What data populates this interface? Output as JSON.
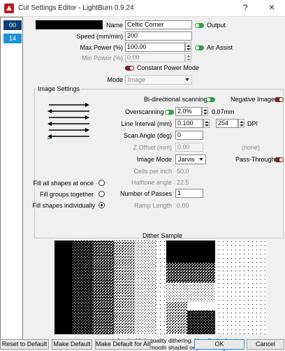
{
  "window": {
    "title": "Cut Settings Editor - LightBurn 0.9.24",
    "help_glyph": "?",
    "close_glyph": "×"
  },
  "layers": [
    {
      "label": "00",
      "color": "#0a3d78"
    },
    {
      "label": "14",
      "color": "#1e90d6"
    }
  ],
  "top": {
    "name_label": "Name",
    "name_value": "Celtic Corner",
    "output_label": "Output",
    "speed_label": "Speed (mm/min)",
    "speed_value": "200",
    "max_power_label": "Max Power (%)",
    "max_power_value": "100.00",
    "air_assist_label": "Air Assist",
    "min_power_label": "Min Power (%)",
    "min_power_value": "0.00",
    "constant_power_label": "Constant Power Mode",
    "mode_label": "Mode",
    "mode_value": "Image"
  },
  "image_settings": {
    "group_label": "Image Settings",
    "bidirectional_label": "Bi-directional scanning",
    "negative_label": "Negative Image",
    "overscanning_label": "Overscanning",
    "overscanning_value": "2.0%",
    "overscanning_mm": "0.07mm",
    "line_interval_label": "Line Interval (mm)",
    "line_interval_value": "0.100",
    "dpi_value": "254",
    "dpi_label": "DPI",
    "scan_angle_label": "Scan Angle (deg)",
    "scan_angle_value": "0",
    "z_offset_label": "Z Offset (mm)",
    "z_offset_value": "0.00",
    "z_offset_extra": "(none)",
    "image_mode_label": "Image Mode",
    "image_mode_value": "Jarvis",
    "pass_through_label": "Pass-Through",
    "cells_label": "Cells per inch",
    "cells_value": "50.0",
    "halftone_label": "Halftone angle",
    "halftone_value": "22.5",
    "passes_label": "Number of Passes",
    "passes_value": "1",
    "ramp_label": "Ramp Length",
    "ramp_value": "0.00",
    "fill_all_label": "Fill all shapes at once",
    "fill_groups_label": "Fill groups together",
    "fill_individually_label": "Fill shapes individually"
  },
  "dither": {
    "label": "Dither Sample",
    "caption_line1": "Jarvis: High quality dithering. Usually the best",
    "caption_line2": "choice for smooth shaded or photo images."
  },
  "footer": {
    "reset_label": "Reset to Default",
    "make_default_label": "Make Default",
    "make_default_all_label": "Make Default for All",
    "ok_label": "OK",
    "cancel_label": "Cancel"
  }
}
